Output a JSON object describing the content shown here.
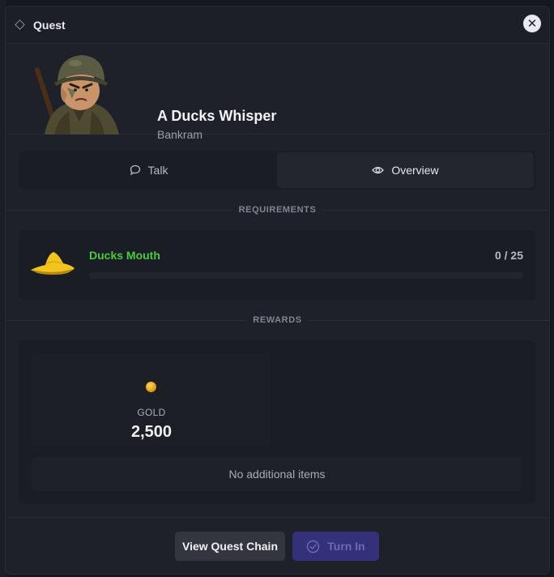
{
  "modal": {
    "title": "Quest",
    "close_icon": "close-icon"
  },
  "quest": {
    "title": "A Ducks Whisper",
    "npc_name": "Bankram"
  },
  "tabs": [
    {
      "label": "Talk",
      "icon": "chat-bubble-icon",
      "active": false
    },
    {
      "label": "Overview",
      "icon": "eye-icon",
      "active": true
    }
  ],
  "requirements": {
    "heading": "REQUIREMENTS",
    "items": [
      {
        "name": "Ducks Mouth",
        "progress_text": "0 / 25",
        "current": 0,
        "target": 25,
        "icon": "ducks-mouth-icon"
      }
    ]
  },
  "rewards": {
    "heading": "REWARDS",
    "gold_label": "GOLD",
    "gold_value": "2,500",
    "no_items_text": "No additional items"
  },
  "footer": {
    "view_chain_label": "View Quest Chain",
    "turn_in_label": "Turn In",
    "turn_in_disabled": true
  },
  "colors": {
    "accent_green": "#4ccb3c",
    "turn_in_bg": "#34307a",
    "gold": "#e0a21a"
  }
}
